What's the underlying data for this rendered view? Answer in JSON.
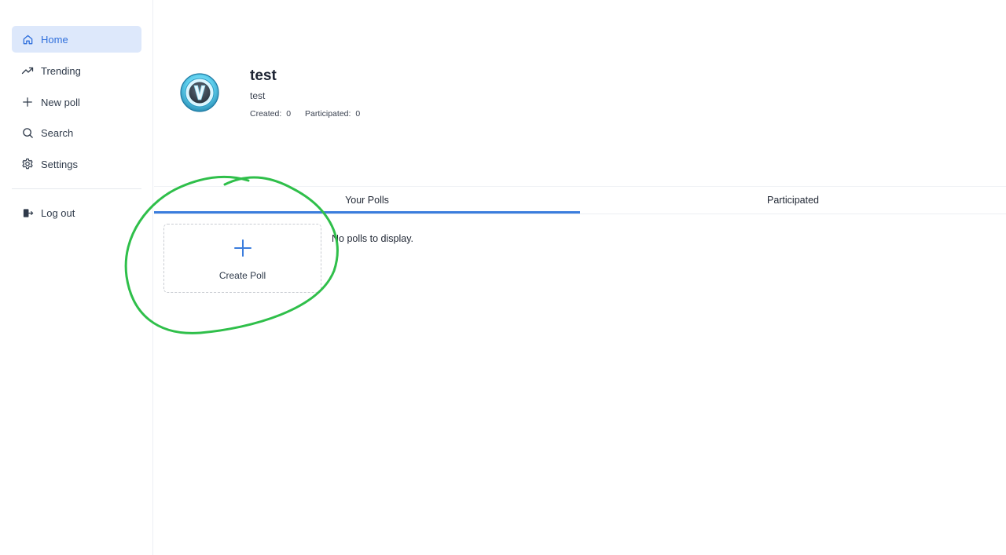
{
  "sidebar": {
    "items": [
      {
        "label": "Home",
        "icon": "home-icon",
        "active": true
      },
      {
        "label": "Trending",
        "icon": "trending-icon"
      },
      {
        "label": "New poll",
        "icon": "plus-icon"
      },
      {
        "label": "Search",
        "icon": "search-icon"
      },
      {
        "label": "Settings",
        "icon": "gear-icon"
      }
    ],
    "logout": {
      "label": "Log out",
      "icon": "logout-icon"
    }
  },
  "profile": {
    "avatar_icon": "v-bucks-avatar",
    "name": "test",
    "handle": "test",
    "created_label": "Created:",
    "created_count": "0",
    "participated_label": "Participated:",
    "participated_count": "0"
  },
  "tabs": [
    {
      "label": "Your Polls",
      "active": true
    },
    {
      "label": "Participated"
    }
  ],
  "content": {
    "create_label": "Create Poll",
    "create_icon": "plus-icon",
    "empty_message": "No polls to display."
  },
  "colors": {
    "accent": "#3b7ddd",
    "active_nav_bg": "#dde8fb",
    "annotation": "#2fbf4a"
  }
}
